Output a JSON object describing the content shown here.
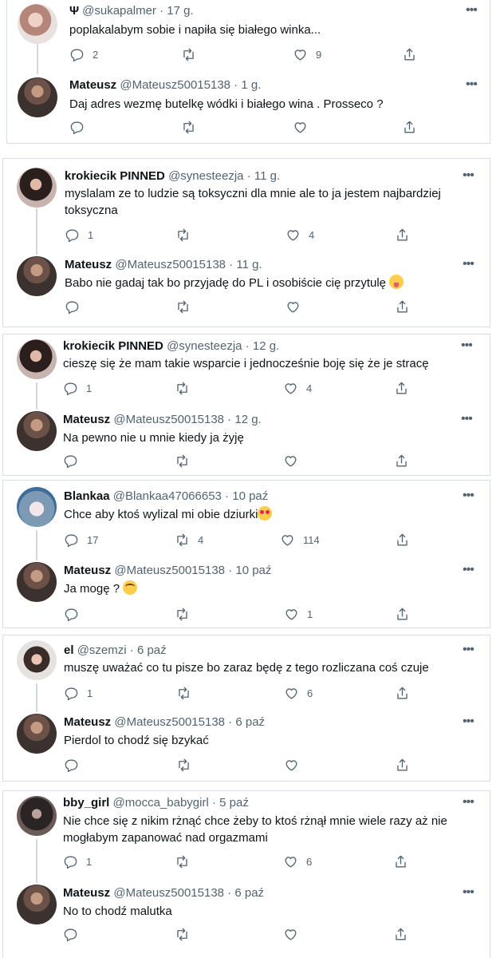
{
  "emojis": {
    "tongue": "winking-face-with-tongue",
    "hearts": "smiling-face-with-heart-eyes",
    "roll": "face-with-rolling-eyes"
  },
  "threads": [
    {
      "parent": {
        "psi": "Ψ",
        "name": "",
        "handle": "@sukapalmer",
        "time": "17 g.",
        "text": "poplakalabym sobie i napiła się białego winka...",
        "replies": "2",
        "retweets": "",
        "likes": "9"
      },
      "reply": {
        "name": "Mateusz",
        "handle": "@Mateusz50015138",
        "time": "1 g.",
        "text": "Daj adres wezmę butelkę wódki i białego wina . Prosseco ?",
        "replies": "",
        "retweets": "",
        "likes": ""
      }
    },
    {
      "parent": {
        "name": "krokiecik PINNED",
        "handle": "@synesteezja",
        "time": "11 g.",
        "text": "myslalam ze to ludzie są toksyczni dla mnie ale to  ja jestem najbardziej toksyczna",
        "replies": "1",
        "retweets": "",
        "likes": "4"
      },
      "reply": {
        "name": "Mateusz",
        "handle": "@Mateusz50015138",
        "time": "11 g.",
        "text": "Babo nie gadaj tak bo przyjadę do PL i osobiście cię przytulę",
        "replies": "",
        "retweets": "",
        "likes": ""
      }
    },
    {
      "parent": {
        "name": "krokiecik PINNED",
        "handle": "@synesteezja",
        "time": "12 g.",
        "text": "cieszę się że mam takie wsparcie i jednocześnie boję się że je stracę",
        "replies": "1",
        "retweets": "",
        "likes": "4"
      },
      "reply": {
        "name": "Mateusz",
        "handle": "@Mateusz50015138",
        "time": "12 g.",
        "text": "Na pewno nie u mnie kiedy ja żyję",
        "replies": "",
        "retweets": "",
        "likes": ""
      }
    },
    {
      "parent": {
        "name": "Blankaa",
        "handle": "@Blankaa47066653",
        "time": "10 paź",
        "text": "Chce aby ktoś  wylizal mi obie dziurki",
        "replies": "17",
        "retweets": "4",
        "likes": "114"
      },
      "reply": {
        "name": "Mateusz",
        "handle": "@Mateusz50015138",
        "time": "10 paź",
        "text": "Ja mogę ?",
        "replies": "",
        "retweets": "",
        "likes": "1"
      }
    },
    {
      "parent": {
        "name": "el",
        "handle": "@szemzi",
        "time": "6 paź",
        "text": "muszę uważać co tu pisze bo zaraz będę z tego rozliczana coś czuje",
        "replies": "1",
        "retweets": "",
        "likes": "6"
      },
      "reply": {
        "name": "Mateusz",
        "handle": "@Mateusz50015138",
        "time": "6 paź",
        "text": "Pierdol to chodź się bzykać",
        "replies": "",
        "retweets": "",
        "likes": ""
      }
    },
    {
      "parent": {
        "name": "bby_girl",
        "handle": "@mocca_babygirl",
        "time": "5 paź",
        "text": "Nie chce się z nikim rżnąć chce żeby to ktoś rżnął mnie wiele razy aż nie mogłabym zapanować nad orgazmami",
        "replies": "1",
        "retweets": "",
        "likes": "6"
      },
      "reply": {
        "name": "Mateusz",
        "handle": "@Mateusz50015138",
        "time": "6 paź",
        "text": "No to chodź malutka",
        "replies": "",
        "retweets": "",
        "likes": ""
      }
    }
  ]
}
